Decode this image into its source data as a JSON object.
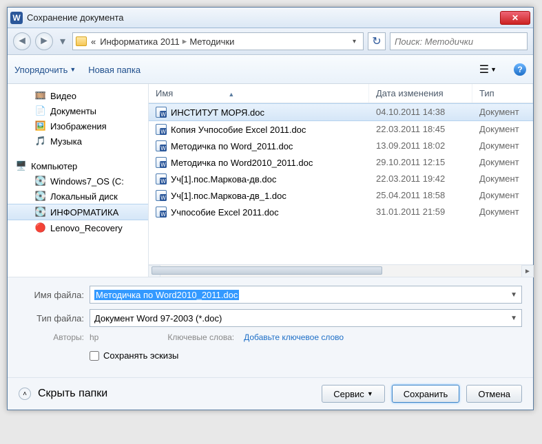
{
  "window": {
    "title": "Сохранение документа"
  },
  "nav": {
    "path_prefix": "«",
    "crumb1": "Информатика 2011",
    "crumb2": "Методички",
    "search_placeholder": "Поиск: Методички"
  },
  "toolbar": {
    "organize": "Упорядочить",
    "new_folder": "Новая папка"
  },
  "tree": {
    "items": [
      {
        "label": "Видео",
        "icon": "🎞️"
      },
      {
        "label": "Документы",
        "icon": "📄"
      },
      {
        "label": "Изображения",
        "icon": "🖼️"
      },
      {
        "label": "Музыка",
        "icon": "🎵"
      }
    ],
    "computer": "Компьютер",
    "drives": [
      {
        "label": "Windows7_OS (C:"
      },
      {
        "label": "Локальный диск"
      },
      {
        "label": "ИНФОРМАТИКА"
      },
      {
        "label": "Lenovo_Recovery"
      }
    ]
  },
  "list": {
    "cols": {
      "name": "Имя",
      "date": "Дата изменения",
      "type": "Тип"
    },
    "rows": [
      {
        "name": "ИНСТИТУТ МОРЯ.doc",
        "date": "04.10.2011 14:38",
        "type": "Документ",
        "selected": true
      },
      {
        "name": "Копия Учпособие Excel 2011.doc",
        "date": "22.03.2011 18:45",
        "type": "Документ"
      },
      {
        "name": "Методичка по Word_2011.doc",
        "date": "13.09.2011 18:02",
        "type": "Документ"
      },
      {
        "name": "Методичка по Word2010_2011.doc",
        "date": "29.10.2011 12:15",
        "type": "Документ"
      },
      {
        "name": "Уч[1].пос.Маркова-дв.doc",
        "date": "22.03.2011 19:42",
        "type": "Документ"
      },
      {
        "name": "Уч[1].пос.Маркова-дв_1.doc",
        "date": "25.04.2011 18:58",
        "type": "Документ"
      },
      {
        "name": "Учпособие Excel 2011.doc",
        "date": "31.01.2011 21:59",
        "type": "Документ"
      }
    ]
  },
  "form": {
    "filename_label": "Имя файла:",
    "filename_value": "Методичка по Word2010_2011.doc",
    "filetype_label": "Тип файла:",
    "filetype_value": "Документ Word 97-2003 (*.doc)",
    "authors_label": "Авторы:",
    "authors_value": "hp",
    "tags_label": "Ключевые слова:",
    "tags_value": "Добавьте ключевое слово",
    "thumb_label": "Сохранять эскизы"
  },
  "footer": {
    "hide_folders": "Скрыть папки",
    "service": "Сервис",
    "save": "Сохранить",
    "cancel": "Отмена"
  }
}
